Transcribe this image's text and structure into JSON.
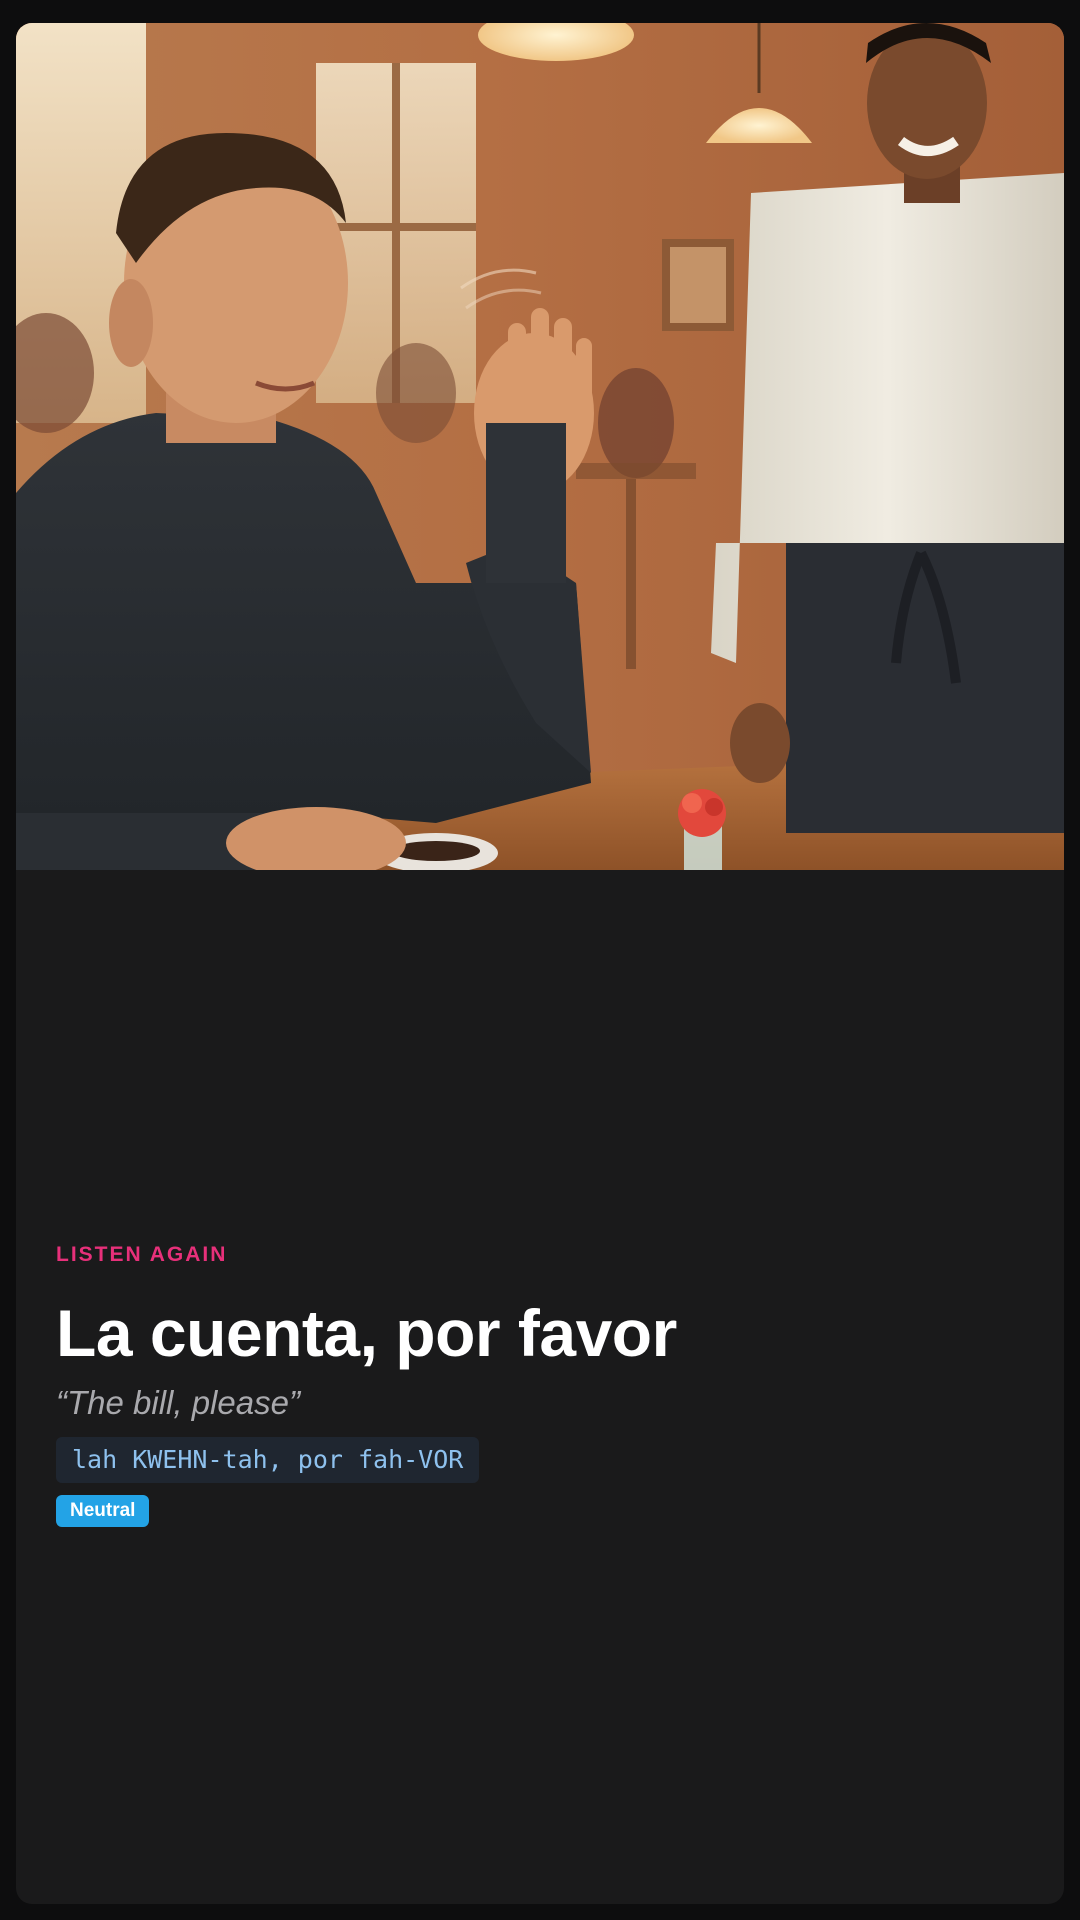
{
  "card": {
    "image_alt": "Man at a cafe table raising his hand to a smiling waiter",
    "eyebrow": "LISTEN AGAIN",
    "phrase": "La cuenta, por favor",
    "translation": "“The bill, please”",
    "pronunciation": "lah KWEHN-tah, por fah-VOR",
    "register_badge": "Neutral"
  },
  "colors": {
    "page_background": "#0d0d0e",
    "card_background": "#1a1a1b",
    "eyebrow": "#e7307a",
    "phrase": "#ffffff",
    "translation": "#a9a9ad",
    "pronunciation_text": "#8ec1ee",
    "pronunciation_background": "#1f2630",
    "badge_background": "#23a3e6"
  }
}
